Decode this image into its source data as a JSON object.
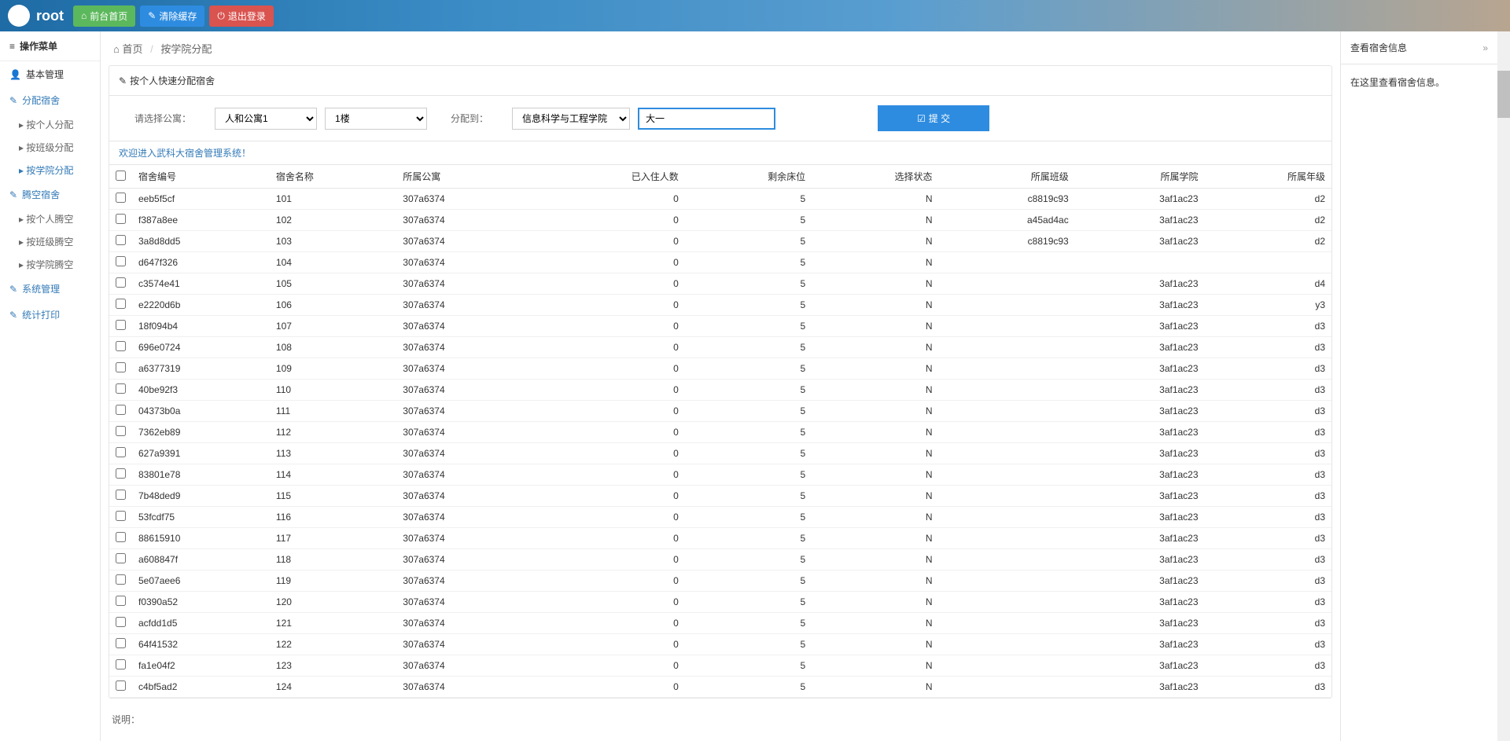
{
  "header": {
    "username": "root",
    "btn_home": "前台首页",
    "btn_clear": "清除缓存",
    "btn_logout": "退出登录"
  },
  "sidebar": {
    "menu_title": "操作菜单",
    "sections": [
      {
        "label": "基本管理",
        "icon": "user"
      },
      {
        "label": "分配宿舍",
        "icon": "edit",
        "blue": true,
        "subs": [
          {
            "label": "按个人分配"
          },
          {
            "label": "按班级分配"
          },
          {
            "label": "按学院分配",
            "active": true
          }
        ]
      },
      {
        "label": "腾空宿舍",
        "icon": "edit",
        "blue": true,
        "subs": [
          {
            "label": "按个人腾空"
          },
          {
            "label": "按班级腾空"
          },
          {
            "label": "按学院腾空"
          }
        ]
      },
      {
        "label": "系统管理",
        "icon": "edit",
        "blue": true
      },
      {
        "label": "统计打印",
        "icon": "edit",
        "blue": true
      }
    ]
  },
  "breadcrumb": {
    "home": "首页",
    "current": "按学院分配"
  },
  "panel_title": "按个人快速分配宿舍",
  "filters": {
    "label_apartment": "请选择公寓：",
    "apartment": "人和公寓1",
    "floor": "1楼",
    "label_assign": "分配到：",
    "college": "信息科学与工程学院",
    "grade": "大一",
    "submit": "提 交"
  },
  "welcome": "欢迎进入武科大宿舍管理系统！",
  "columns": [
    "宿舍编号",
    "宿舍名称",
    "所属公寓",
    "已入住人数",
    "剩余床位",
    "选择状态",
    "所属班级",
    "所属学院",
    "所属年级"
  ],
  "rows": [
    {
      "id": "eeb5f5cf",
      "name": "101",
      "apt": "307a6374",
      "in": "0",
      "left": "5",
      "sel": "N",
      "cls": "c8819c93",
      "col": "3af1ac23",
      "gr": "d2"
    },
    {
      "id": "f387a8ee",
      "name": "102",
      "apt": "307a6374",
      "in": "0",
      "left": "5",
      "sel": "N",
      "cls": "a45ad4ac",
      "col": "3af1ac23",
      "gr": "d2"
    },
    {
      "id": "3a8d8dd5",
      "name": "103",
      "apt": "307a6374",
      "in": "0",
      "left": "5",
      "sel": "N",
      "cls": "c8819c93",
      "col": "3af1ac23",
      "gr": "d2"
    },
    {
      "id": "d647f326",
      "name": "104",
      "apt": "307a6374",
      "in": "0",
      "left": "5",
      "sel": "N",
      "cls": "",
      "col": "",
      "gr": ""
    },
    {
      "id": "c3574e41",
      "name": "105",
      "apt": "307a6374",
      "in": "0",
      "left": "5",
      "sel": "N",
      "cls": "",
      "col": "3af1ac23",
      "gr": "d4"
    },
    {
      "id": "e2220d6b",
      "name": "106",
      "apt": "307a6374",
      "in": "0",
      "left": "5",
      "sel": "N",
      "cls": "",
      "col": "3af1ac23",
      "gr": "y3"
    },
    {
      "id": "18f094b4",
      "name": "107",
      "apt": "307a6374",
      "in": "0",
      "left": "5",
      "sel": "N",
      "cls": "",
      "col": "3af1ac23",
      "gr": "d3"
    },
    {
      "id": "696e0724",
      "name": "108",
      "apt": "307a6374",
      "in": "0",
      "left": "5",
      "sel": "N",
      "cls": "",
      "col": "3af1ac23",
      "gr": "d3"
    },
    {
      "id": "a6377319",
      "name": "109",
      "apt": "307a6374",
      "in": "0",
      "left": "5",
      "sel": "N",
      "cls": "",
      "col": "3af1ac23",
      "gr": "d3"
    },
    {
      "id": "40be92f3",
      "name": "110",
      "apt": "307a6374",
      "in": "0",
      "left": "5",
      "sel": "N",
      "cls": "",
      "col": "3af1ac23",
      "gr": "d3"
    },
    {
      "id": "04373b0a",
      "name": "111",
      "apt": "307a6374",
      "in": "0",
      "left": "5",
      "sel": "N",
      "cls": "",
      "col": "3af1ac23",
      "gr": "d3"
    },
    {
      "id": "7362eb89",
      "name": "112",
      "apt": "307a6374",
      "in": "0",
      "left": "5",
      "sel": "N",
      "cls": "",
      "col": "3af1ac23",
      "gr": "d3"
    },
    {
      "id": "627a9391",
      "name": "113",
      "apt": "307a6374",
      "in": "0",
      "left": "5",
      "sel": "N",
      "cls": "",
      "col": "3af1ac23",
      "gr": "d3"
    },
    {
      "id": "83801e78",
      "name": "114",
      "apt": "307a6374",
      "in": "0",
      "left": "5",
      "sel": "N",
      "cls": "",
      "col": "3af1ac23",
      "gr": "d3"
    },
    {
      "id": "7b48ded9",
      "name": "115",
      "apt": "307a6374",
      "in": "0",
      "left": "5",
      "sel": "N",
      "cls": "",
      "col": "3af1ac23",
      "gr": "d3"
    },
    {
      "id": "53fcdf75",
      "name": "116",
      "apt": "307a6374",
      "in": "0",
      "left": "5",
      "sel": "N",
      "cls": "",
      "col": "3af1ac23",
      "gr": "d3"
    },
    {
      "id": "88615910",
      "name": "117",
      "apt": "307a6374",
      "in": "0",
      "left": "5",
      "sel": "N",
      "cls": "",
      "col": "3af1ac23",
      "gr": "d3"
    },
    {
      "id": "a608847f",
      "name": "118",
      "apt": "307a6374",
      "in": "0",
      "left": "5",
      "sel": "N",
      "cls": "",
      "col": "3af1ac23",
      "gr": "d3"
    },
    {
      "id": "5e07aee6",
      "name": "119",
      "apt": "307a6374",
      "in": "0",
      "left": "5",
      "sel": "N",
      "cls": "",
      "col": "3af1ac23",
      "gr": "d3"
    },
    {
      "id": "f0390a52",
      "name": "120",
      "apt": "307a6374",
      "in": "0",
      "left": "5",
      "sel": "N",
      "cls": "",
      "col": "3af1ac23",
      "gr": "d3"
    },
    {
      "id": "acfdd1d5",
      "name": "121",
      "apt": "307a6374",
      "in": "0",
      "left": "5",
      "sel": "N",
      "cls": "",
      "col": "3af1ac23",
      "gr": "d3"
    },
    {
      "id": "64f41532",
      "name": "122",
      "apt": "307a6374",
      "in": "0",
      "left": "5",
      "sel": "N",
      "cls": "",
      "col": "3af1ac23",
      "gr": "d3"
    },
    {
      "id": "fa1e04f2",
      "name": "123",
      "apt": "307a6374",
      "in": "0",
      "left": "5",
      "sel": "N",
      "cls": "",
      "col": "3af1ac23",
      "gr": "d3"
    },
    {
      "id": "c4bf5ad2",
      "name": "124",
      "apt": "307a6374",
      "in": "0",
      "left": "5",
      "sel": "N",
      "cls": "",
      "col": "3af1ac23",
      "gr": "d3"
    }
  ],
  "note_label": "说明：",
  "rightpanel": {
    "title": "查看宿舍信息",
    "body": "在这里查看宿舍信息。",
    "toggle": "»"
  }
}
